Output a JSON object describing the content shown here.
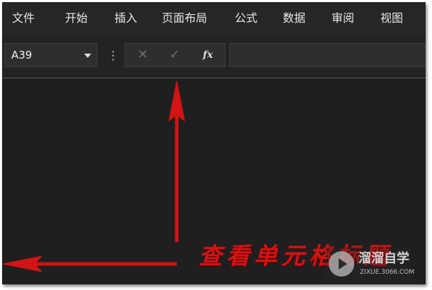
{
  "menubar": {
    "items": [
      {
        "label": "文件"
      },
      {
        "label": "开始"
      },
      {
        "label": "插入"
      },
      {
        "label": "页面布局"
      },
      {
        "label": "公式"
      },
      {
        "label": "数据"
      },
      {
        "label": "审阅"
      },
      {
        "label": "视图"
      }
    ]
  },
  "formula_bar": {
    "name_box_value": "A39",
    "more_icon": "⋮",
    "cancel_icon": "✕",
    "enter_icon": "✓",
    "fx_label": "fx",
    "formula_value": ""
  },
  "annotation": {
    "caption": "查看单元格标题",
    "arrow_color": "#d21414"
  },
  "watermark": {
    "title": "溜溜自学",
    "url": "ZIXUE.3066.COM"
  }
}
